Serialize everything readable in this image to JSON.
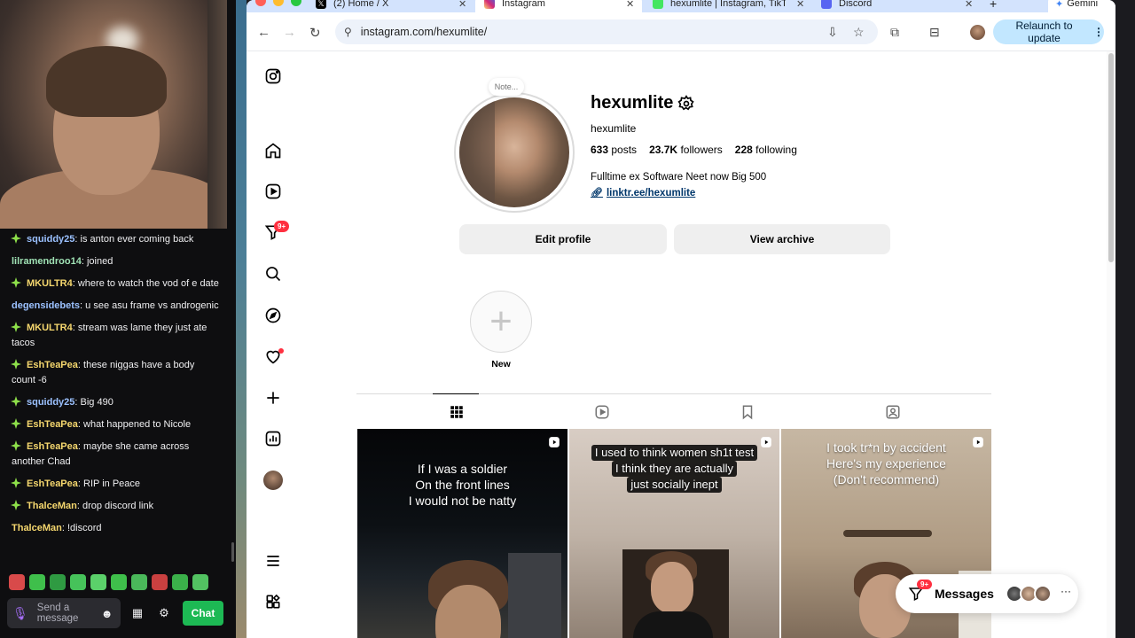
{
  "stream": {
    "chat_messages": [
      {
        "user": "squiddy25",
        "text": "is anton ever coming back",
        "color": "#9bc1ff",
        "badge": true
      },
      {
        "user": "lilramendroo14",
        "text": "joined",
        "color": "#9fe1b4",
        "badge": false
      },
      {
        "user": "MKULTR4",
        "text": "where to watch the vod of e date",
        "color": "#f5d76e",
        "badge": true
      },
      {
        "user": "degensidebets",
        "text": "u see asu frame vs androgenic",
        "color": "#9bc1ff",
        "badge": false
      },
      {
        "user": "MKULTR4",
        "text": "stream was lame they just ate tacos",
        "color": "#f5d76e",
        "badge": true
      },
      {
        "user": "EshTeaPea",
        "text": "these niggas have a body count -6",
        "color": "#f5d76e",
        "badge": true
      },
      {
        "user": "squiddy25",
        "text": "Big 490",
        "color": "#9bc1ff",
        "badge": true
      },
      {
        "user": "EshTeaPea",
        "text": "what happened to Nicole",
        "color": "#f5d76e",
        "badge": true
      },
      {
        "user": "EshTeaPea",
        "text": "maybe she came across another Chad",
        "color": "#f5d76e",
        "badge": true
      },
      {
        "user": "EshTeaPea",
        "text": "RIP in Peace",
        "color": "#f5d76e",
        "badge": true
      },
      {
        "user": "ThalceMan",
        "text": "drop discord link",
        "color": "#f5d76e",
        "badge": true
      },
      {
        "user": "ThalceMan",
        "text": "!discord",
        "color": "#f5d76e",
        "badge": false
      }
    ],
    "composer_placeholder": "Send a message",
    "chat_button": "Chat"
  },
  "browser": {
    "tabs": [
      {
        "label": "(2) Home / X",
        "icon": "x-logo-icon"
      },
      {
        "label": "Instagram",
        "icon": "instagram-icon"
      },
      {
        "label": "hexumlite | Instagram, TikTo",
        "icon": "linktree-icon"
      },
      {
        "label": "Discord",
        "icon": "discord-icon"
      },
      {
        "label": "Gemini",
        "icon": "gemini-icon"
      }
    ],
    "url": "instagram.com/hexumlite/",
    "relaunch_label": "Relaunch to update"
  },
  "profile": {
    "note": "Note...",
    "username": "hexumlite",
    "full_name": "hexumlite",
    "posts": "633",
    "posts_label": "posts",
    "followers": "23.7K",
    "followers_label": "followers",
    "following": "228",
    "following_label": "following",
    "bio": "Fulltime ex Software Neet now Big 500",
    "link": "linktr.ee/hexumlite",
    "edit_profile": "Edit profile",
    "view_archive": "View archive",
    "new_highlight": "New",
    "notif_count": "9+"
  },
  "posts": [
    {
      "caption_lines": [
        "If I was a soldier",
        "On the front lines",
        "I would not be natty"
      ]
    },
    {
      "caption_lines": [
        "I used to think women sh1t test",
        "I think they are actually",
        "just socially inept"
      ]
    },
    {
      "caption_lines": [
        "I took tr*n by accident",
        "Here's my experience",
        "(Don't recommend)"
      ]
    }
  ],
  "messages": {
    "label": "Messages",
    "badge": "9+",
    "more": "···"
  }
}
